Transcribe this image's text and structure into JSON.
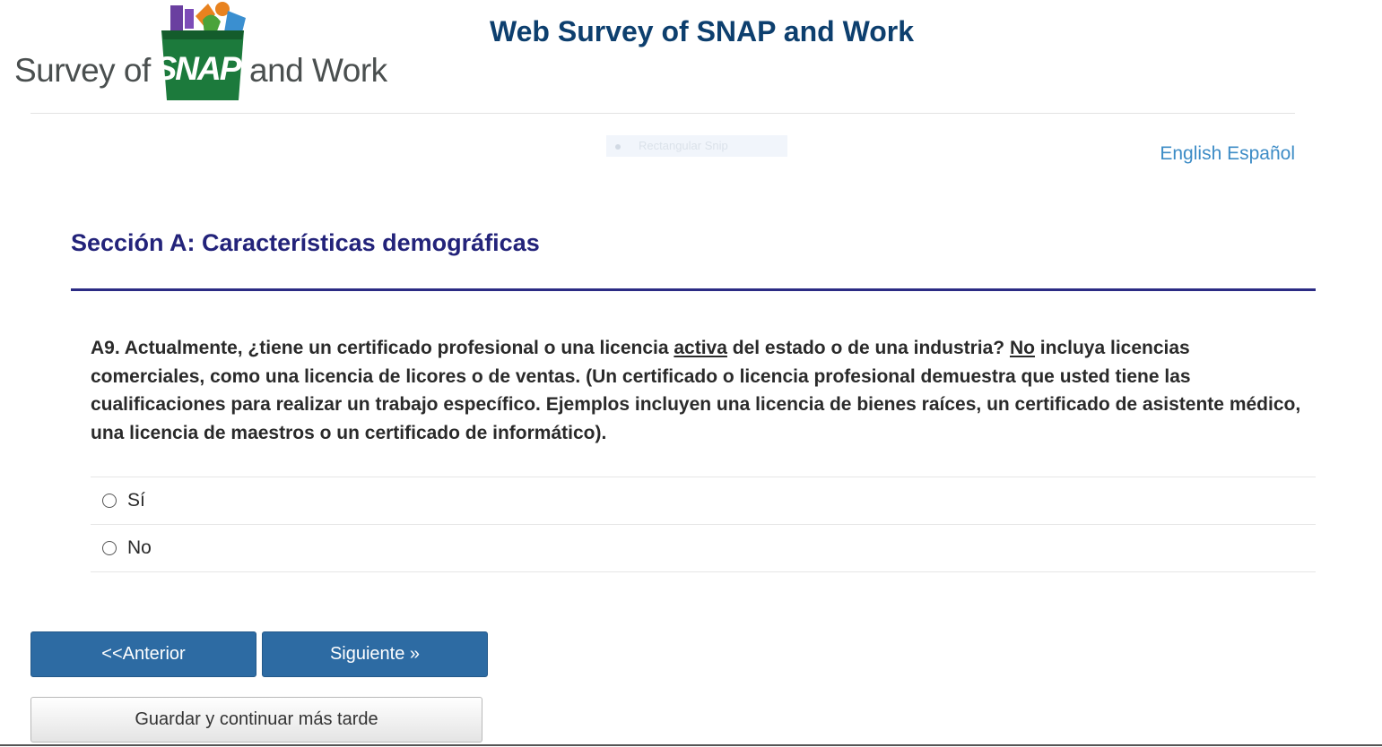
{
  "header": {
    "logo": {
      "text_left": "Survey of",
      "text_brand": "SNAP",
      "text_right": "and Work"
    },
    "site_title": "Web Survey of SNAP and Work"
  },
  "overlay": {
    "snip_label": "Rectangular Snip"
  },
  "language": {
    "english": "English",
    "spanish": "Español"
  },
  "section": {
    "title": "Sección A: Características demográficas"
  },
  "question": {
    "part1": "A9. Actualmente, ¿tiene un certificado profesional o una licencia ",
    "emphasis1": "activa",
    "part2": " del estado o de una industria? ",
    "emphasis2": "No",
    "part3": " incluya licencias comerciales, como una licencia de licores o de ventas. (Un certificado o licencia profesional demuestra que usted tiene las cualificaciones para realizar un trabajo específico. Ejemplos incluyen una licencia de bienes raíces, un certificado de asistente médico, una licencia de maestros o un certificado de informático)."
  },
  "options": [
    {
      "label": "Sí"
    },
    {
      "label": "No"
    }
  ],
  "buttons": {
    "previous": "<<Anterior",
    "next": "Siguiente »",
    "save": "Guardar y continuar más tarde"
  },
  "colors": {
    "site_title": "#0d3f6e",
    "section_title": "#23237a",
    "link": "#3d8cc6",
    "primary_button": "#2d6ba3",
    "logo_green": "#1c7a3c"
  }
}
